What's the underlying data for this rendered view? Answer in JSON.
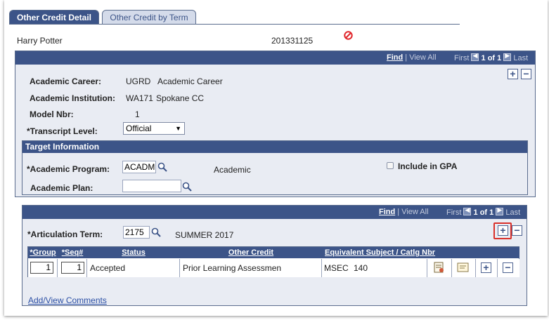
{
  "tabs": {
    "active": "Other Credit Detail",
    "inactive": "Other Credit by Term"
  },
  "student": {
    "name": "Harry Potter",
    "id": "201331125"
  },
  "top_nav": {
    "find": "Find",
    "view_all": "View All",
    "first": "First",
    "count": "1 of 1",
    "last": "Last"
  },
  "detail": {
    "career_label": "Academic Career:",
    "career_code": "UGRD",
    "career_desc": "Academic Career",
    "institution_label": "Academic Institution:",
    "institution_code": "WA171",
    "institution_desc": "Spokane CC",
    "model_label": "Model Nbr:",
    "model_value": "1",
    "transcript_label": "*Transcript Level:",
    "transcript_value": "Official"
  },
  "target": {
    "header": "Target Information",
    "program_label": "*Academic Program:",
    "program_value": "ACADM",
    "program_desc": "Academic",
    "include_gpa": "Include in GPA",
    "plan_label": "Academic Plan:",
    "plan_value": ""
  },
  "lower_nav": {
    "find": "Find",
    "view_all": "View All",
    "first": "First",
    "count": "1 of 1",
    "last": "Last"
  },
  "term": {
    "label": "*Articulation Term:",
    "value": "2175",
    "desc": "SUMMER 2017"
  },
  "grid": {
    "headers": [
      "*Group",
      "*Seq#",
      "Status",
      "Other Credit",
      "Equivalent Subject / Catlg Nbr"
    ],
    "rows": [
      {
        "group": "1",
        "seq": "1",
        "status": "Accepted",
        "other_credit": "Prior Learning Assessmen",
        "subject": "MSEC",
        "catalog": "140"
      }
    ]
  },
  "comments_link": "Add/View Comments",
  "colors": {
    "header_blue": "#3c5488",
    "panel_bg": "#e9ecf3",
    "highlight_red": "#d9302a",
    "stop_icon_red": "#e0262b"
  }
}
